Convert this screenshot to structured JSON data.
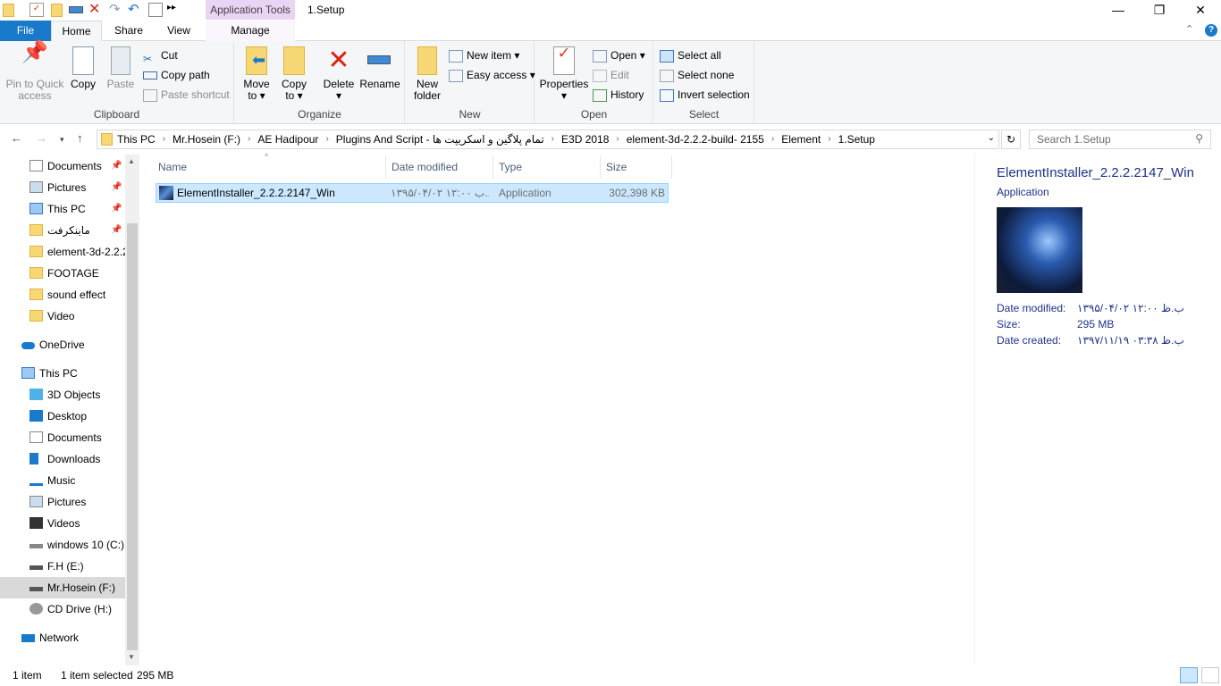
{
  "window": {
    "title": "1.Setup",
    "context_tab": "Application Tools",
    "controls": [
      "minimize",
      "maximize",
      "close"
    ]
  },
  "quick_access": [
    "folder-icon",
    "properties-icon",
    "new-folder-icon",
    "rename-icon",
    "delete-icon",
    "redo-icon",
    "undo-icon",
    "copy-icon",
    "more-icon"
  ],
  "tabs": [
    {
      "label": "File"
    },
    {
      "label": "Home"
    },
    {
      "label": "Share"
    },
    {
      "label": "View"
    },
    {
      "label": "Manage"
    }
  ],
  "ribbon": {
    "clipboard": {
      "label": "Clipboard",
      "pin": "Pin to Quick access",
      "copy": "Copy",
      "paste": "Paste",
      "cut": "Cut",
      "copy_path": "Copy path",
      "paste_shortcut": "Paste shortcut"
    },
    "organize": {
      "label": "Organize",
      "move_to": "Move to",
      "copy_to": "Copy to",
      "delete": "Delete",
      "rename": "Rename"
    },
    "new": {
      "label": "New",
      "new_folder": "New folder",
      "new_item": "New item",
      "easy_access": "Easy access"
    },
    "open": {
      "label": "Open",
      "properties": "Properties",
      "open": "Open",
      "edit": "Edit",
      "history": "History"
    },
    "select": {
      "label": "Select",
      "select_all": "Select all",
      "select_none": "Select none",
      "invert": "Invert selection"
    }
  },
  "address": {
    "crumbs": [
      "This PC",
      "Mr.Hosein (F:)",
      "AE Hadipour",
      "Plugins And Script - تمام پلاگین و اسکریپت ها",
      "E3D 2018",
      "element-3d-2.2.2-build- 2155",
      "Element",
      "1.Setup"
    ],
    "search_placeholder": "Search 1.Setup"
  },
  "sidebar": {
    "quick": [
      {
        "label": "Documents",
        "pinned": true
      },
      {
        "label": "Pictures",
        "pinned": true
      },
      {
        "label": "This PC",
        "pinned": true
      },
      {
        "label": "ماینکرفت",
        "pinned": true
      },
      {
        "label": "element-3d-2.2.2"
      },
      {
        "label": "FOOTAGE"
      },
      {
        "label": "sound effect"
      },
      {
        "label": "Video"
      }
    ],
    "onedrive": "OneDrive",
    "thispc": "This PC",
    "pc_items": [
      {
        "label": "3D Objects"
      },
      {
        "label": "Desktop"
      },
      {
        "label": "Documents"
      },
      {
        "label": "Downloads"
      },
      {
        "label": "Music"
      },
      {
        "label": "Pictures"
      },
      {
        "label": "Videos"
      },
      {
        "label": "windows 10 (C:)"
      },
      {
        "label": "F.H (E:)"
      },
      {
        "label": "Mr.Hosein (F:)",
        "selected": true
      },
      {
        "label": "CD Drive (H:)"
      }
    ],
    "network": "Network"
  },
  "files": {
    "columns": [
      "Name",
      "Date modified",
      "Type",
      "Size"
    ],
    "rows": [
      {
        "name": "ElementInstaller_2.2.2.2147_Win",
        "date": "۱۳۹۵/۰۴/۰۲ ب ۱۲:۰۰....",
        "type": "Application",
        "size": "302,398 KB",
        "selected": true
      }
    ]
  },
  "preview": {
    "name": "ElementInstaller_2.2.2.2147_Win",
    "type": "Application",
    "props": [
      {
        "k": "Date modified:",
        "v": "۱۳۹۵/۰۴/۰۲ ب.ظ ۱۲:۰۰"
      },
      {
        "k": "Size:",
        "v": "295 MB"
      },
      {
        "k": "Date created:",
        "v": "۱۳۹۷/۱۱/۱۹ ب.ظ ۰۳:۳۸"
      }
    ]
  },
  "status": {
    "count": "1 item",
    "selected": "1 item selected",
    "size": "295 MB"
  },
  "colors": {
    "accent": "#1979ca",
    "selection": "#cce8ff",
    "context_tab": "#e9d4f4"
  }
}
